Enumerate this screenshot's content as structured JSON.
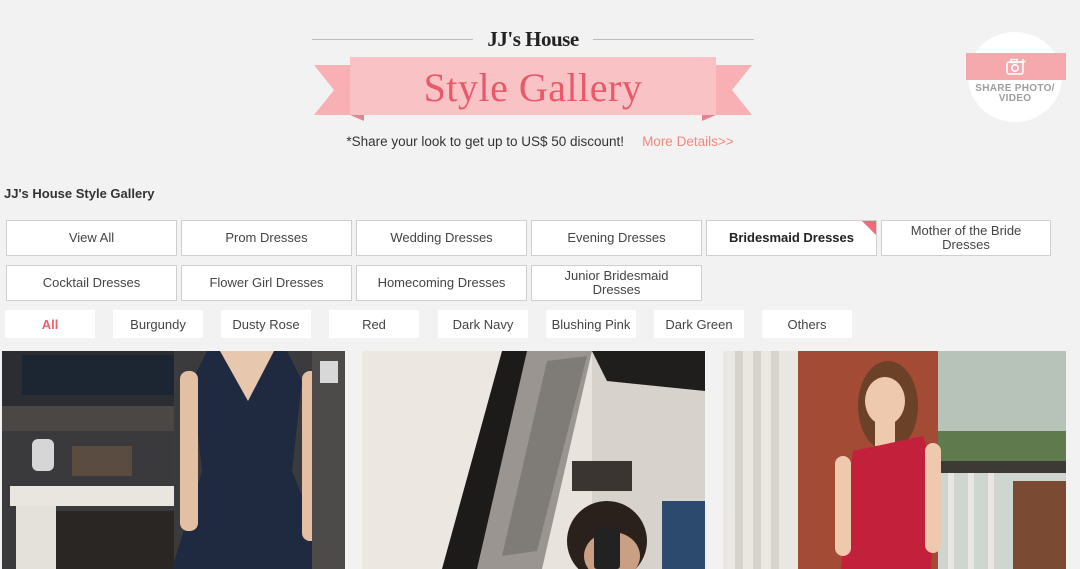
{
  "header": {
    "brand": "JJ's House",
    "title": "Style Gallery",
    "promo_text": "*Share your look to get up to US$ 50 discount!",
    "more_details": "More Details>>"
  },
  "share": {
    "label": "SHARE PHOTO/ VIDEO",
    "icon": "camera-plus-icon"
  },
  "section_title": "JJ's House Style Gallery",
  "categories": [
    "View All",
    "Prom Dresses",
    "Wedding Dresses",
    "Evening Dresses",
    "Bridesmaid Dresses",
    "Mother of the Bride Dresses",
    "Cocktail Dresses",
    "Flower Girl Dresses",
    "Homecoming Dresses",
    "Junior Bridesmaid Dresses"
  ],
  "active_category": "Bridesmaid Dresses",
  "colors": [
    "All",
    "Burgundy",
    "Dusty Rose",
    "Red",
    "Dark Navy",
    "Blushing Pink",
    "Dark Green",
    "Others"
  ],
  "active_color": "All",
  "palette": {
    "accent": "#f0606f",
    "ribbon": "#f8b8bc",
    "ribbon_dark": "#e8868e",
    "link": "#f08a7e"
  },
  "photos": [
    {
      "dress_color": "Dark Navy"
    },
    {
      "dress_color": ""
    },
    {
      "dress_color": "Red"
    }
  ]
}
